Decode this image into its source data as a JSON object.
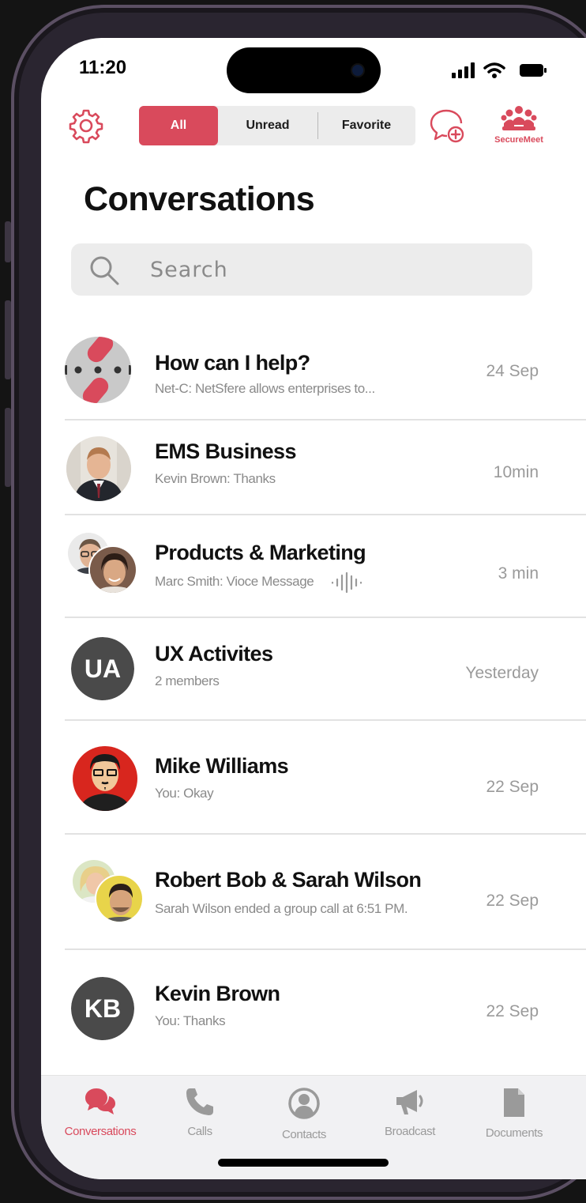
{
  "status_bar": {
    "time": "11:20"
  },
  "header": {
    "filters": {
      "all": "All",
      "unread": "Unread",
      "favorite": "Favorite"
    },
    "secure_meet_label": "SecureMeet",
    "title": "Conversations"
  },
  "search": {
    "placeholder": "Search"
  },
  "conversations": [
    {
      "name": "How can I help?",
      "preview": "Net-C: NetSfere allows enterprises to...",
      "time": "24 Sep"
    },
    {
      "name": "EMS Business",
      "preview": "Kevin Brown: Thanks",
      "time": "10min"
    },
    {
      "name": "Products & Marketing",
      "preview": "Marc Smith: Vioce Message",
      "time": "3 min"
    },
    {
      "name": "UX Activites",
      "preview": "2 members",
      "time": "Yesterday",
      "initials": "UA"
    },
    {
      "name": "Mike Williams",
      "preview": "You: Okay",
      "time": "22 Sep"
    },
    {
      "name": "Robert Bob & Sarah Wilson",
      "preview": "Sarah Wilson ended a group call at 6:51 PM.",
      "time": "22 Sep"
    },
    {
      "name": "Kevin Brown",
      "preview": "You: Thanks",
      "time": "22 Sep",
      "initials": "KB"
    }
  ],
  "bottom_nav": [
    {
      "label": "Conversations",
      "icon": "chat-bubbles-icon",
      "active": true
    },
    {
      "label": "Calls",
      "icon": "phone-icon"
    },
    {
      "label": "Contacts",
      "icon": "user-circle-icon"
    },
    {
      "label": "Broadcast",
      "icon": "megaphone-icon"
    },
    {
      "label": "Documents",
      "icon": "document-icon"
    }
  ],
  "colors": {
    "accent": "#d94a5c",
    "text": "#111111",
    "muted": "#8a8a8a",
    "avatar_bg": "#4a4a4a"
  }
}
